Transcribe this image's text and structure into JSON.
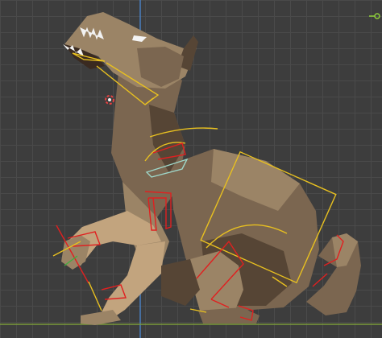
{
  "viewport": {
    "grid_color": "#4a4a4a",
    "background_color": "#3d3d3d",
    "axis_y_color": "#4a7fc0",
    "axis_x_color": "#7a9a3a"
  },
  "model": {
    "subject": "low-poly wolf",
    "fur_light": "#9b8466",
    "fur_mid": "#7b6650",
    "fur_dark": "#564535",
    "fur_pale": "#c2a47e"
  },
  "rig": {
    "bone_color_primary": "#e8c020",
    "bone_color_secondary": "#e02020",
    "bone_color_selected": "#9ed7c9"
  },
  "icons": [
    "3d-cursor-icon",
    "viewport-object-origin-icon"
  ]
}
